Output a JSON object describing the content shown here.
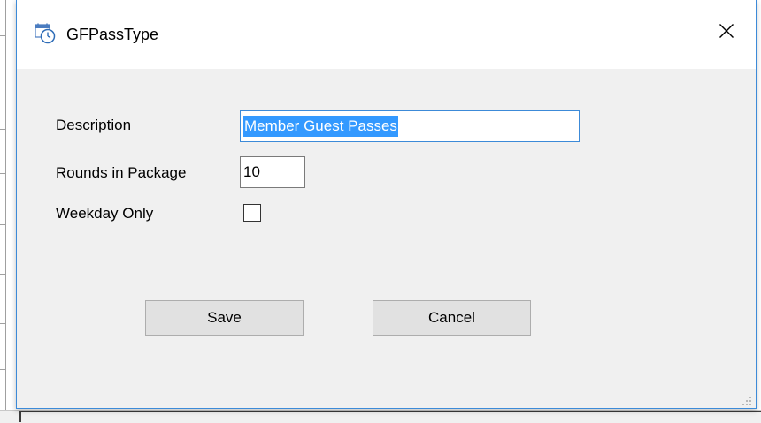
{
  "window": {
    "title": "GFPassType",
    "icon": "calendar-clock-icon",
    "close_icon": "close-icon"
  },
  "form": {
    "description_label": "Description",
    "description_value": "Member Guest Passes",
    "rounds_label": "Rounds in Package",
    "rounds_value": "10",
    "weekday_label": "Weekday Only",
    "weekday_checked": false
  },
  "buttons": {
    "save_label": "Save",
    "cancel_label": "Cancel"
  },
  "colors": {
    "accent": "#3c8ad8",
    "selection": "#3399ff",
    "dialog_bg": "#f0f0f0",
    "button_bg": "#e1e1e1"
  }
}
